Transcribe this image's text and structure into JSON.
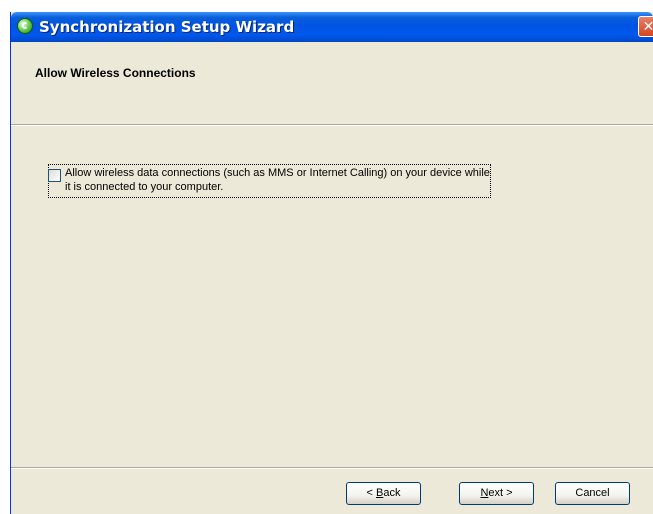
{
  "window": {
    "title": "Synchronization Setup Wizard",
    "close_glyph": "✕"
  },
  "header": {
    "title": "Allow Wireless Connections"
  },
  "option": {
    "checked": false,
    "label": "Allow wireless data connections (such as MMS or Internet Calling) on your device while it is connected to your computer."
  },
  "buttons": {
    "back": {
      "prefix": "< ",
      "accel": "B",
      "rest": "ack"
    },
    "next": {
      "accel": "N",
      "rest": "ext >"
    },
    "cancel": "Cancel"
  },
  "colors": {
    "titlebar": "#0054e3",
    "dialog_bg": "#ece9d8",
    "close": "#d2461f"
  }
}
